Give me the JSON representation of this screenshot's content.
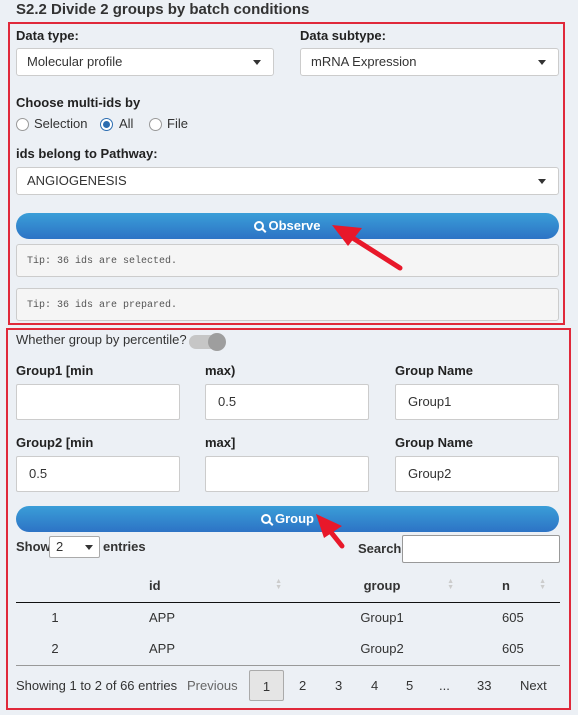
{
  "title": "S2.2 Divide 2 groups by batch conditions",
  "data_type": {
    "label": "Data type:",
    "value": "Molecular profile"
  },
  "data_subtype": {
    "label": "Data subtype:",
    "value": "mRNA Expression"
  },
  "multi_ids": {
    "label": "Choose multi-ids by",
    "options": [
      "Selection",
      "All",
      "File"
    ],
    "selected": "All"
  },
  "pathway": {
    "label": "ids belong to Pathway:",
    "value": "ANGIOGENESIS"
  },
  "observe_button": "Observe",
  "tips": [
    "Tip: 36 ids are selected.",
    "Tip: 36 ids are prepared."
  ],
  "percentile": {
    "label": "Whether group by percentile?",
    "enabled": false
  },
  "group1": {
    "min_label": "Group1 [min",
    "max_label": "max)",
    "name_label": "Group Name",
    "min": "",
    "max": "0.5",
    "name": "Group1"
  },
  "group2": {
    "min_label": "Group2 [min",
    "max_label": "max]",
    "name_label": "Group Name",
    "min": "0.5",
    "max": "",
    "name": "Group2"
  },
  "group_button": "Group",
  "table_controls": {
    "show": "Show",
    "entries_value": "2",
    "entries": "entries",
    "search_label": "Search:",
    "search_value": ""
  },
  "table": {
    "columns": [
      "",
      "id",
      "group",
      "n"
    ],
    "rows": [
      [
        "1",
        "APP",
        "Group1",
        "605"
      ],
      [
        "2",
        "APP",
        "Group2",
        "605"
      ]
    ]
  },
  "pagination": {
    "info": "Showing 1 to 2 of 66 entries",
    "previous": "Previous",
    "pages": [
      "1",
      "2",
      "3",
      "4",
      "5",
      "...",
      "33"
    ],
    "current": "1",
    "next": "Next"
  },
  "colors": {
    "highlight_border": "#e0293a",
    "button": "#2d73c5",
    "arrow": "#e8182a"
  }
}
